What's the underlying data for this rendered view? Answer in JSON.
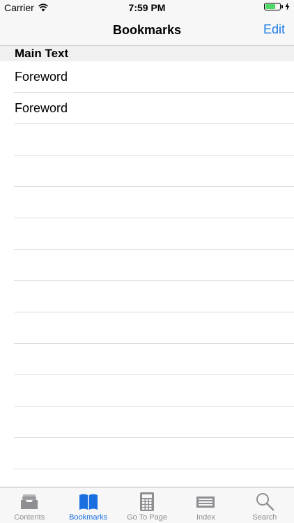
{
  "status_bar": {
    "carrier": "Carrier",
    "time": "7:59 PM",
    "battery_level": 0.7
  },
  "nav": {
    "title": "Bookmarks",
    "edit_label": "Edit"
  },
  "section": {
    "title": "Main Text"
  },
  "rows": [
    {
      "label": "Foreword"
    },
    {
      "label": "Foreword"
    },
    {
      "label": ""
    },
    {
      "label": ""
    },
    {
      "label": ""
    },
    {
      "label": ""
    },
    {
      "label": ""
    },
    {
      "label": ""
    },
    {
      "label": ""
    },
    {
      "label": ""
    },
    {
      "label": ""
    },
    {
      "label": ""
    },
    {
      "label": ""
    }
  ],
  "tabs": [
    {
      "label": "Contents",
      "icon": "inbox-tray-icon",
      "active": false
    },
    {
      "label": "Bookmarks",
      "icon": "open-book-icon",
      "active": true
    },
    {
      "label": "Go To Page",
      "icon": "calculator-icon",
      "active": false
    },
    {
      "label": "Index",
      "icon": "index-card-icon",
      "active": false
    },
    {
      "label": "Search",
      "icon": "search-icon",
      "active": false
    }
  ],
  "colors": {
    "accent": "#1a7be6",
    "active_tab": "#1a6fe0",
    "battery": "#4cd964",
    "inactive_icon": "#8e8e93"
  }
}
